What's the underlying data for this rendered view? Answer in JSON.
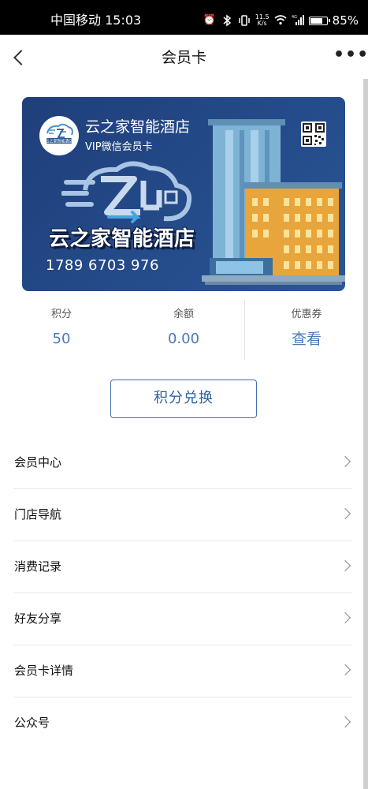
{
  "status_bar": {
    "carrier": "中国移动",
    "time": "15:03",
    "net_speed_value": "11.5",
    "net_speed_unit": "K/s",
    "network": "4G",
    "battery_percent": "85%",
    "battery_level": 0.85,
    "icons": [
      "alarm-icon",
      "bluetooth-icon",
      "vibrate-icon",
      "wifi-icon",
      "signal-icon",
      "battery-icon"
    ]
  },
  "nav": {
    "title": "会员卡",
    "back_icon": "chevron-left-icon",
    "more_icon": "more-dots-icon",
    "more_label": "•••"
  },
  "card": {
    "hotel_name": "云之家智能酒店",
    "card_type": "VIP微信会员卡",
    "brand_text": "云之家智能酒店",
    "card_number": "1789 6703 976",
    "logo_caption": "云之家智能酒店",
    "colors": {
      "background": "#244b8a",
      "building_orange": "#e8a53c",
      "building_blue": "#7fb3d5"
    }
  },
  "stats": {
    "points_label": "积分",
    "points_value": "50",
    "balance_label": "余额",
    "balance_value": "0.00",
    "coupon_label": "优惠券",
    "coupon_action": "查看"
  },
  "exchange_button": "积分兑换",
  "menu": [
    {
      "label": "会员中心"
    },
    {
      "label": "门店导航"
    },
    {
      "label": "消费记录"
    },
    {
      "label": "好友分享"
    },
    {
      "label": "会员卡详情"
    },
    {
      "label": "公众号"
    }
  ],
  "colors": {
    "accent": "#3e6fae",
    "value_text": "#4a7ab8"
  }
}
